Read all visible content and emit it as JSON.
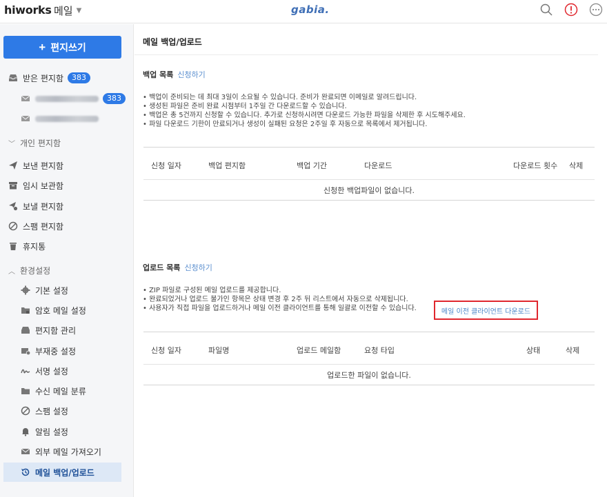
{
  "topbar": {
    "brand": "hiworks",
    "mail_menu": "메일",
    "logo": "gabia."
  },
  "sidebar": {
    "write_label": "편지쓰기",
    "inbox": {
      "label": "받은 편지함",
      "count": "383"
    },
    "accounts": [
      {
        "count": "383"
      },
      {
        "count": ""
      }
    ],
    "personal_section": "개인 편지함",
    "folders": [
      "보낸 편지함",
      "임시 보관함",
      "보낼 편지함",
      "스팸 편지함",
      "휴지통"
    ],
    "settings_section": "환경설정",
    "settings_items": [
      "기본 설정",
      "암호 메일 설정",
      "편지함 관리",
      "부재중 설정",
      "서명 설정",
      "수신 메일 분류",
      "스팸 설정",
      "알림 설정",
      "외부 메일 가져오기",
      "메일 백업/업로드"
    ]
  },
  "main": {
    "title": "메일 백업/업로드",
    "backup": {
      "heading": "백업 목록",
      "request": "신청하기",
      "notes": [
        "백업이 준비되는 데 최대 3일이 소요될 수 있습니다. 준비가 완료되면 이메일로 알려드립니다.",
        "생성된 파일은 준비 완료 시점부터 1주일 간 다운로드할 수 있습니다.",
        "백업은 총 5건까지 신청할 수 있습니다. 추가로 신청하시려면 다운로드 가능한 파일을 삭제한 후 시도해주세요.",
        "파일 다운로드 기한이 만료되거나 생성이 실패된 요청은 2주일 후 자동으로 목록에서 제거됩니다."
      ],
      "columns": [
        "신청 일자",
        "백업 편지함",
        "백업 기간",
        "다운로드",
        "다운로드 횟수",
        "삭제"
      ],
      "empty": "신청한 백업파일이 없습니다."
    },
    "upload": {
      "heading": "업로드 목록",
      "request": "신청하기",
      "notes": [
        "ZIP 파일로 구성된 메일 업로드를 제공합니다.",
        "완료되었거나 업로드 불가인 항목은 상태 변경 후 2주 뒤 리스트에서 자동으로 삭제됩니다.",
        "사용자가 직접 파일을 업로드하거나 메일 이전 클라이언트를 통해 일괄로 이전할 수 있습니다."
      ],
      "client_link": "메일 이전 클라이언트 다운로드",
      "columns": [
        "신청 일자",
        "파일명",
        "업로드 메일함",
        "요청 타입",
        "상태",
        "삭제"
      ],
      "empty": "업로드한 파일이 없습니다."
    }
  },
  "colors": {
    "accent": "#2e7ae6",
    "link": "#4a86c8",
    "highlight_border": "#e0262d",
    "alert_icon": "#e0262d"
  }
}
